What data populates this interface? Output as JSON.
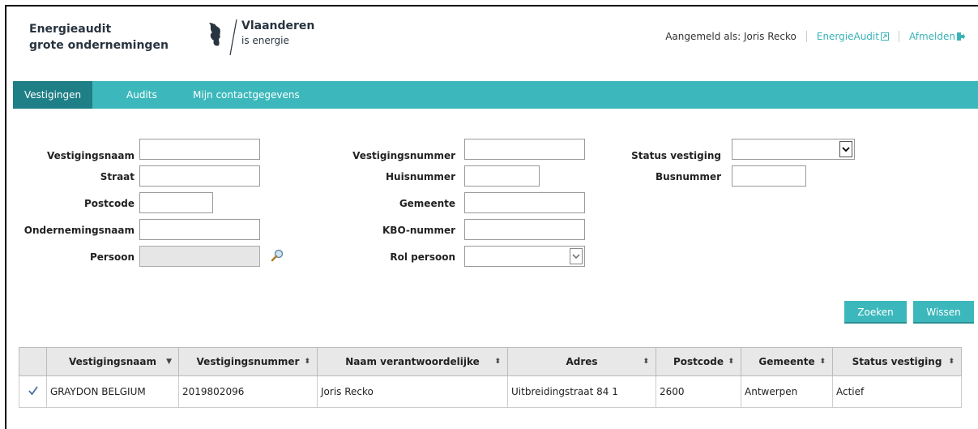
{
  "header": {
    "app_title_line1": "Energieaudit",
    "app_title_line2": "grote ondernemingen",
    "brand_name": "Vlaanderen",
    "brand_sub": "is energie",
    "logged_in_label": "Aangemeld als: Joris Recko",
    "link_energieaudit": "EnergieAudit",
    "link_afmelden": "Afmelden"
  },
  "nav": {
    "tabs": [
      {
        "label": "Vestigingen",
        "active": true
      },
      {
        "label": "Audits",
        "active": false
      },
      {
        "label": "Mijn contactgegevens",
        "active": false
      }
    ]
  },
  "form": {
    "vestigingsnaam": {
      "label": "Vestigingsnaam",
      "value": ""
    },
    "straat": {
      "label": "Straat",
      "value": ""
    },
    "postcode": {
      "label": "Postcode",
      "value": ""
    },
    "ondernemingsnaam": {
      "label": "Ondernemingsnaam",
      "value": ""
    },
    "persoon": {
      "label": "Persoon",
      "value": ""
    },
    "vestigingsnummer": {
      "label": "Vestigingsnummer",
      "value": ""
    },
    "huisnummer": {
      "label": "Huisnummer",
      "value": ""
    },
    "gemeente": {
      "label": "Gemeente",
      "value": ""
    },
    "kbo_nummer": {
      "label": "KBO-nummer",
      "value": ""
    },
    "rol_persoon": {
      "label": "Rol persoon",
      "value": ""
    },
    "status_vestiging": {
      "label": "Status vestiging",
      "value": ""
    },
    "busnummer": {
      "label": "Busnummer",
      "value": ""
    }
  },
  "buttons": {
    "zoeken": "Zoeken",
    "wissen": "Wissen"
  },
  "table": {
    "columns": [
      "Vestigingsnaam",
      "Vestigingsnummer",
      "Naam verantwoordelijke",
      "Adres",
      "Postcode",
      "Gemeente",
      "Status vestiging"
    ],
    "rows": [
      {
        "selected": true,
        "vestigingsnaam": "GRAYDON BELGIUM",
        "vestigingsnummer": "2019802096",
        "naam_verantwoordelijke": "Joris Recko",
        "adres": "Uitbreidingstraat 84 1",
        "postcode": "2600",
        "gemeente": "Antwerpen",
        "status_vestiging": "Actief"
      }
    ]
  },
  "colors": {
    "accent": "#3cb8bc",
    "nav_active": "#1f7f86",
    "link": "#3ab3b7"
  }
}
